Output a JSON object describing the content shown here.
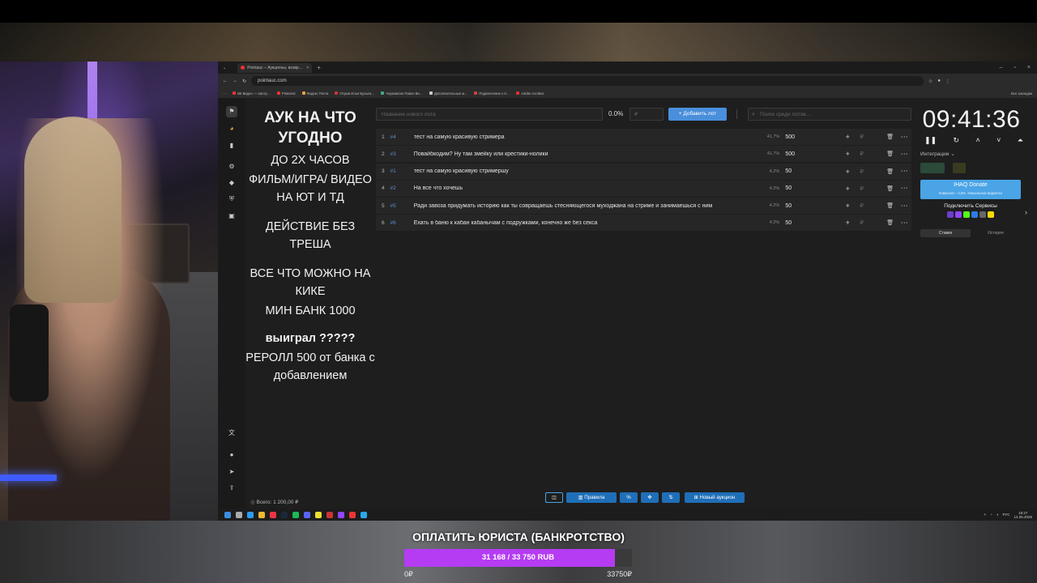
{
  "browser": {
    "tab_title": "Pointauc – Аукционы, возвр…",
    "url": "pointauc.com",
    "bookmarks": [
      {
        "label": "ВК Видео — смотр…",
        "color": "#e33"
      },
      {
        "label": "Pinterest",
        "color": "#e33"
      },
      {
        "label": "Яндекс Почта",
        "color": "#e8a33a"
      },
      {
        "label": "Отрыв Илья Булыга…",
        "color": "#c33"
      },
      {
        "label": "Черемисин Павел Ви…",
        "color": "#4a8"
      },
      {
        "label": "Дополнительные м…",
        "color": "#ccc"
      },
      {
        "label": "Подключение к Н…",
        "color": "#c44"
      },
      {
        "label": "Adobe Acrobat",
        "color": "#d33"
      }
    ],
    "all_bookmarks": "Все закладки"
  },
  "rules": {
    "title": "АУК НА ЧТО УГОДНО",
    "lines": [
      "ДО 2Х ЧАСОВ",
      "ФИЛЬМ/ИГРА/ ВИДЕО НА ЮТ И ТД"
    ],
    "lines2": [
      "ДЕЙСТВИЕ БЕЗ ТРЕША"
    ],
    "lines3": [
      "ВСЕ ЧТО МОЖНО НА КИКЕ",
      "МИН БАНК 1000"
    ],
    "won": "выиграл ?????",
    "reroll": [
      "РЕРОЛЛ 500 от банка с добавлением"
    ]
  },
  "controls": {
    "lot_placeholder": "Название нового лота",
    "percent": "0.0%",
    "sum_placeholder": "₽",
    "add_button": "Добавить лот",
    "search_placeholder": "Поиск среди лотов…"
  },
  "lots": [
    {
      "num": "1",
      "id": "#4",
      "name": "тест на самую красивую стримера",
      "pct": "41.7%",
      "amount": "500"
    },
    {
      "num": "2",
      "id": "#3",
      "name": "Повайбкодим? Ну там змейку или крестики-нолики",
      "pct": "41.7%",
      "amount": "500"
    },
    {
      "num": "3",
      "id": "#1",
      "name": "тест на самую красивую стримершу",
      "pct": "4.2%",
      "amount": "50"
    },
    {
      "num": "4",
      "id": "#2",
      "name": "На все что хочешь",
      "pct": "4.2%",
      "amount": "50"
    },
    {
      "num": "5",
      "id": "#5",
      "name": "Ради завоза придумать историю как ты совращаешь стесняющегося муходжана на стриме и занимаешься с ним",
      "pct": "4.2%",
      "amount": "50"
    },
    {
      "num": "6",
      "id": "#6",
      "name": "Ехать в баню к кабан кабанычам с подружками, конечно же без секса",
      "pct": "4.2%",
      "amount": "50"
    }
  ],
  "timer": "09:41:36",
  "integrations_label": "Интеграции",
  "donate": {
    "title": "IHAQ Donate",
    "sub": "Комиссия – 3,5%. Уникальные виджеты!"
  },
  "services_label": "Подключить Сервисы",
  "side_tabs": [
    "Ставки",
    "История"
  ],
  "total": "Всего: 1 200,00 ₽",
  "bottom": {
    "rules": "Правила",
    "percent": "%",
    "new_auction": "Новый аукцион"
  },
  "taskbar": {
    "lang": "РУС",
    "time": "19:27",
    "date": "14.05.2026"
  },
  "goal": {
    "title": "ОПЛАТИТЬ ЮРИСТА (БАНКРОТСТВО)",
    "current": 31168,
    "target": 33750,
    "text": "31 168 / 33 750 RUB",
    "min_label": "0₽",
    "max_label": "33750₽",
    "fill_color": "#b53cf2"
  }
}
